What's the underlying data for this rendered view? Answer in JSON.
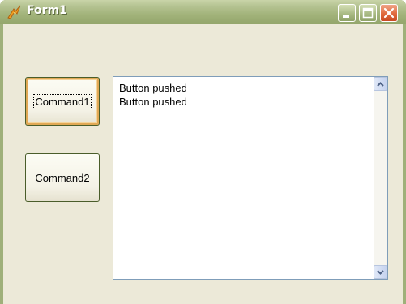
{
  "window": {
    "title": "Form1",
    "icon": "vb-form-icon",
    "controls": [
      "minimize-icon",
      "maximize-icon",
      "close-icon"
    ]
  },
  "buttons": {
    "command1_label": "Command1",
    "command2_label": "Command2"
  },
  "list": {
    "lines": [
      "Button pushed",
      "Button pushed"
    ]
  },
  "colors": {
    "titlebar": "#a2b37a",
    "client": "#ece9d8",
    "listbox_border": "#7f9db9",
    "close_button": "#e06a3c"
  }
}
